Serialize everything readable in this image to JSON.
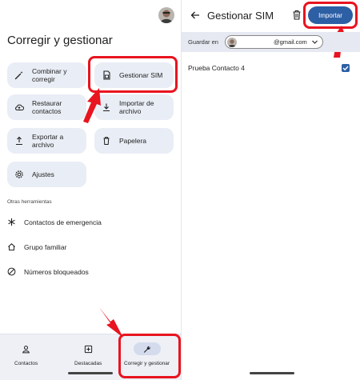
{
  "left": {
    "title": "Corregir y gestionar",
    "tiles": [
      {
        "label": "Combinar y corregir",
        "icon": "magic-wand-icon"
      },
      {
        "label": "Gestionar SIM",
        "icon": "sim-card-icon"
      },
      {
        "label": "Restaurar contactos",
        "icon": "cloud-restore-icon"
      },
      {
        "label": "Importar de archivo",
        "icon": "download-icon"
      },
      {
        "label": "Exportar a archivo",
        "icon": "upload-icon"
      },
      {
        "label": "Papelera",
        "icon": "trash-icon"
      },
      {
        "label": "Ajustes",
        "icon": "gear-icon"
      }
    ],
    "other_tools_label": "Otras herramientas",
    "other_tools": [
      {
        "label": "Contactos de emergencia",
        "icon": "asterisk-icon"
      },
      {
        "label": "Grupo familiar",
        "icon": "home-icon"
      },
      {
        "label": "Números bloqueados",
        "icon": "block-icon"
      }
    ],
    "nav": [
      {
        "label": "Contactos",
        "icon": "person-icon"
      },
      {
        "label": "Destacadas",
        "icon": "star-box-icon"
      },
      {
        "label": "Corregir y gestionar",
        "icon": "wrench-icon"
      }
    ]
  },
  "right": {
    "title": "Gestionar SIM",
    "import_label": "Importar",
    "save_label": "Guardar en",
    "account_email": "@gmail.com",
    "contact_name": "Prueba Contacto 4"
  },
  "colors": {
    "accent": "#2d5fa5",
    "tile_bg": "#e9edf5",
    "highlight": "#e8141f"
  }
}
